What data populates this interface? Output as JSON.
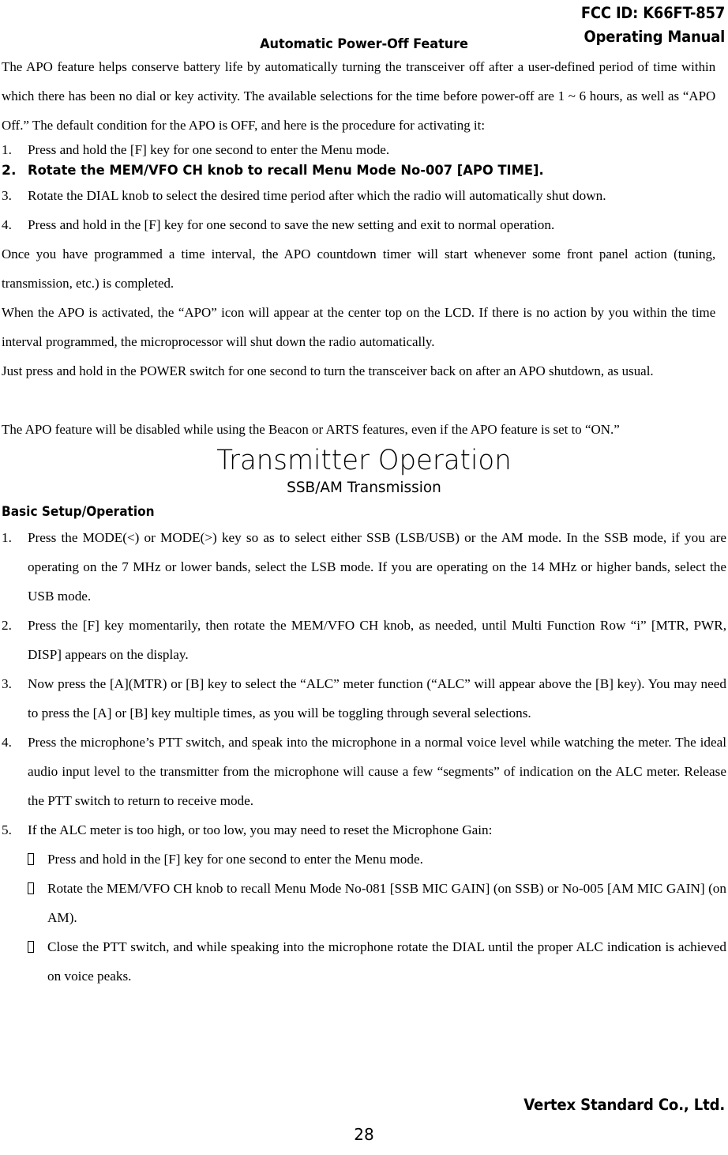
{
  "header": {
    "fcc_id": "FCC ID: K66FT-857",
    "doc_type": "Operating Manual"
  },
  "apo_section": {
    "title": "Automatic Power-Off Feature",
    "intro": "The APO feature helps conserve battery life by automatically turning the transceiver off after a user-defined period of time within which there has been no dial or key activity. The available selections for the time before power-off are 1 ~ 6 hours, as well as “APO Off.” The default condition for the APO is OFF, and here is the procedure for activating it:",
    "steps": [
      {
        "num": "1.",
        "text": "Press and hold the [F] key for one second to enter the Menu mode.",
        "style": "serif"
      },
      {
        "num": "2.",
        "text": "Rotate the MEM/VFO CH knob to recall Menu Mode No-007 [APO TIME].",
        "style": "sans"
      },
      {
        "num": "3.",
        "text": "Rotate the DIAL knob to select the desired time period after which the radio will automatically shut down.",
        "style": "serif"
      },
      {
        "num": "4.",
        "text": "Press and hold in the [F] key for one second to save the new setting and exit to normal operation.",
        "style": "serif"
      }
    ],
    "paragraphs": [
      "Once you have programmed a time interval, the APO countdown timer will start whenever some front panel action (tuning, transmission, etc.) is completed.",
      "When the APO is activated, the “APO” icon will appear at the center top on the LCD. If there is no action by you within the time interval programmed, the microprocessor will shut down the radio automatically.",
      "Just press and hold in the POWER switch for one second to turn the transceiver back on after an APO shutdown, as usual."
    ],
    "note": "The APO feature will be disabled while using the Beacon or ARTS features, even if the APO feature is set to “ON.”"
  },
  "transmitter_section": {
    "title": "Transmitter Operation",
    "subtitle": "SSB/AM Transmission",
    "heading": "Basic Setup/Operation",
    "steps": [
      {
        "num": "1.",
        "text": "Press the MODE(<) or MODE(>) key so as to select either SSB (LSB/USB) or the AM mode. In the SSB mode, if you are operating on the 7 MHz or lower bands, select the LSB mode. If you are operating on the 14 MHz or higher bands, select the USB mode."
      },
      {
        "num": "2.",
        "text": "Press the [F] key momentarily, then rotate the MEM/VFO CH knob, as needed, until Multi Function Row “i” [MTR, PWR, DISP] appears on the display."
      },
      {
        "num": "3.",
        "text": "Now press the [A](MTR) or [B] key to select the “ALC” meter function (“ALC” will appear above the [B] key). You may need to press the [A] or [B] key multiple times, as you will be toggling through several selections."
      },
      {
        "num": "4.",
        "text": "Press the microphone’s PTT switch, and speak into the microphone in a normal voice level while watching the meter. The ideal audio input level to the transmitter from the microphone will cause a few “segments” of indication on the ALC meter. Release the PTT switch to return to receive mode."
      },
      {
        "num": "5.",
        "text": "If the ALC meter is too high, or too low, you may need to reset the Microphone Gain:"
      }
    ],
    "sub_steps": [
      "Press and hold in the [F] key for one second to enter the Menu mode.",
      "Rotate the MEM/VFO CH knob to recall Menu Mode No-081 [SSB MIC GAIN] (on SSB) or No-005 [AM MIC GAIN] (on AM).",
      "Close the PTT switch, and while speaking into the microphone rotate the DIAL until the proper ALC indication is achieved on voice peaks."
    ]
  },
  "footer": {
    "company": "Vertex Standard Co., Ltd.",
    "page_number": "28"
  }
}
